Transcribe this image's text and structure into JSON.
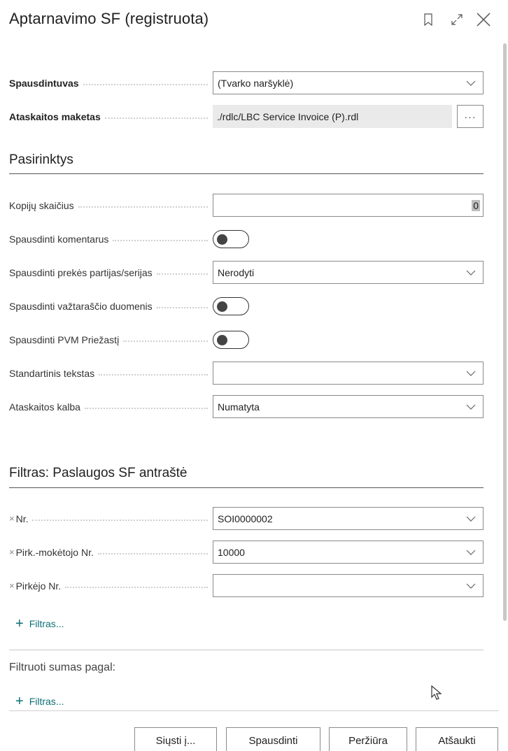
{
  "dialog": {
    "title": "Aptarnavimo SF (registruota)"
  },
  "icons": {
    "bookmark": "bookmark-icon",
    "expand": "expand-icon",
    "close": "close-icon"
  },
  "top_fields": {
    "printer": {
      "label": "Spausdintuvas",
      "value": "(Tvarko naršyklė)"
    },
    "layout": {
      "label": "Ataskaitos maketas",
      "value": "./rdlc/LBC Service Invoice (P).rdl",
      "button": "···"
    }
  },
  "options": {
    "title": "Pasirinktys",
    "copies": {
      "label": "Kopijų skaičius",
      "value": "0"
    },
    "print_comments": {
      "label": "Spausdinti komentarus",
      "on": false
    },
    "print_lots": {
      "label": "Spausdinti prekės partijas/serijas",
      "value": "Nerodyti"
    },
    "print_shipment": {
      "label": "Spausdinti važtaraščio duomenis",
      "on": false
    },
    "print_vat": {
      "label": "Spausdinti PVM Priežastį",
      "on": false
    },
    "standard_text": {
      "label": "Standartinis tekstas",
      "value": ""
    },
    "report_language": {
      "label": "Ataskaitos kalba",
      "value": "Numatyta"
    }
  },
  "filters": {
    "title": "Filtras: Paslaugos SF antraštė",
    "items": [
      {
        "label": "Nr.",
        "value": "SOI0000002"
      },
      {
        "label": "Pirk.-mokėtojo Nr.",
        "value": "10000"
      },
      {
        "label": "Pirkėjo Nr.",
        "value": ""
      }
    ],
    "remove_glyph": "×",
    "add_label": "Filtras...",
    "totals_title": "Filtruoti sumas pagal:",
    "totals_add_label": "Filtras..."
  },
  "buttons": {
    "send": "Siųsti į...",
    "print": "Spausdinti",
    "preview": "Peržiūra",
    "cancel": "Atšaukti"
  }
}
